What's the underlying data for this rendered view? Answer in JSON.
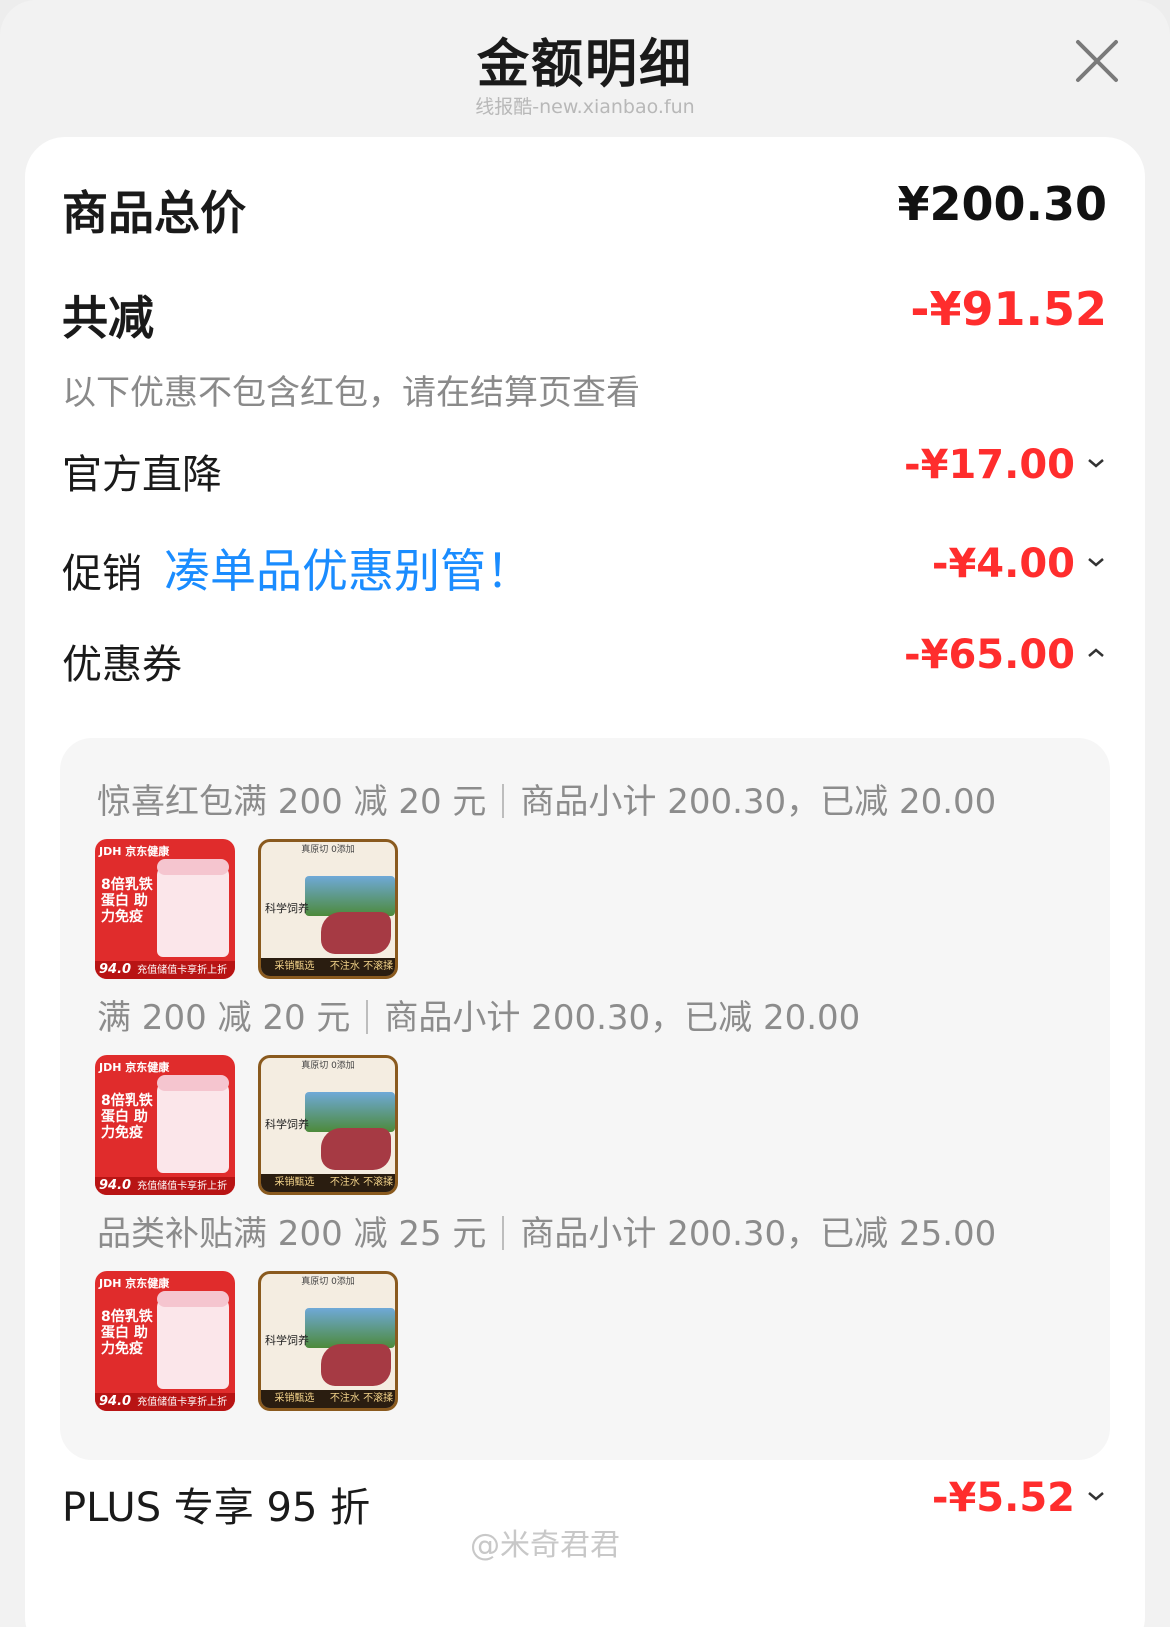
{
  "header": {
    "title": "金额明细",
    "watermark": "线报酷-new.xianbao.fun"
  },
  "summary": {
    "total_label": "商品总价",
    "total_value": "¥200.30",
    "reduction_label": "共减",
    "reduction_value": "-¥91.52",
    "note": "以下优惠不包含红包，请在结算页查看"
  },
  "lines": {
    "official_label": "官方直降",
    "official_value": "-¥17.00",
    "promo_label": "促销",
    "promo_link": "凑单品优惠别管！",
    "promo_value": "-¥4.00",
    "coupon_label": "优惠券",
    "coupon_value": "-¥65.00",
    "plus_label": "PLUS 专享 95 折",
    "plus_value": "-¥5.52"
  },
  "coupons": [
    {
      "name": "惊喜红包满 200 减 20 元",
      "detail": "商品小计 200.30，已减 20.00"
    },
    {
      "name": "满 200 减 20 元",
      "detail": "商品小计 200.30，已减 20.00"
    },
    {
      "name": "品类补贴满 200 减 25 元",
      "detail": "商品小计 200.30，已减 25.00"
    }
  ],
  "products": {
    "p1": {
      "brand": "JDH 京东健康",
      "headline": "8倍乳铁蛋白 助力免疫",
      "price": "94.0",
      "banner": "充值储值卡享折上折"
    },
    "p2": {
      "top": "真原切 0添加",
      "tagline": "科学饲养",
      "left_badge": "采销甄选",
      "right_badge": "不注水 不滚揉"
    }
  },
  "footer": {
    "watermark": "@米奇君君"
  },
  "colors": {
    "red": "#ff2d2d",
    "blue": "#1a8cff"
  }
}
